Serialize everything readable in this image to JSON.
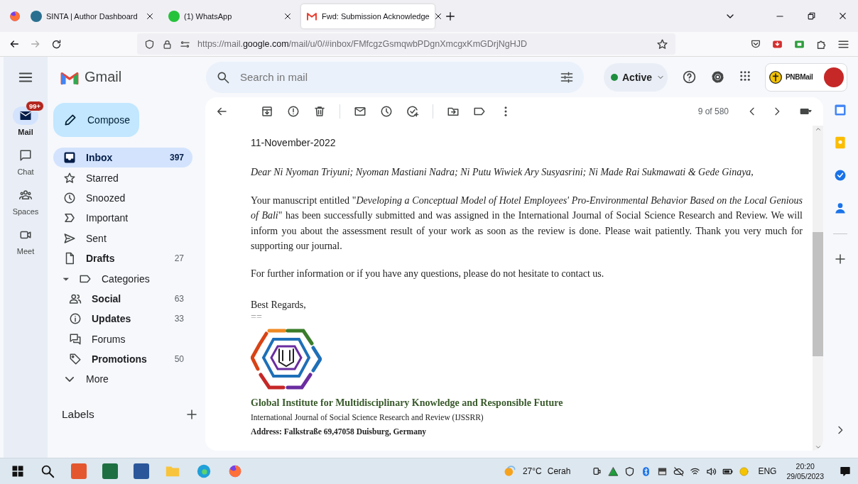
{
  "browser": {
    "tabs": [
      {
        "title": "SINTA | Author Dashboard",
        "selected": false
      },
      {
        "title": "(1) WhatsApp",
        "selected": false
      },
      {
        "title": "Fwd: Submission Acknowledge",
        "selected": true
      }
    ],
    "url": "https://mail.**google.com**/mail/u/0/#inbox/FMfcgzGsmqwbPDgnXmcgxKmGDrjNgHJD"
  },
  "gmail": {
    "app_name": "Gmail",
    "search": {
      "placeholder": "Search in mail"
    },
    "status": "Active",
    "account_logo": "PNBMail",
    "rail": [
      {
        "label": "Mail",
        "selected": true,
        "badge": "99+"
      },
      {
        "label": "Chat",
        "selected": false
      },
      {
        "label": "Spaces",
        "selected": false
      },
      {
        "label": "Meet",
        "selected": false
      }
    ],
    "compose": "Compose",
    "nav": [
      {
        "label": "Inbox",
        "count": "397",
        "bold": true,
        "selected": true
      },
      {
        "label": "Starred",
        "bold": false,
        "selected": false
      },
      {
        "label": "Snoozed",
        "bold": false,
        "selected": false
      },
      {
        "label": "Important",
        "bold": false,
        "selected": false
      },
      {
        "label": "Sent",
        "bold": false,
        "selected": false
      },
      {
        "label": "Drafts",
        "count": "27",
        "bold": true,
        "selected": false
      },
      {
        "label": "Categories",
        "bold": false,
        "selected": false,
        "expanded": true,
        "children": [
          {
            "label": "Social",
            "count": "63",
            "bold": true,
            "selected": false
          },
          {
            "label": "Updates",
            "count": "33",
            "bold": true,
            "selected": false
          },
          {
            "label": "Forums",
            "bold": false,
            "selected": false
          },
          {
            "label": "Promotions",
            "count": "50",
            "bold": true,
            "selected": false
          }
        ]
      },
      {
        "label": "More",
        "bold": false,
        "selected": false
      }
    ],
    "labels_heading": "Labels",
    "pager": "9 of 580",
    "message": {
      "date": "11-November-2022",
      "greeting": "Dear Ni Nyoman Triyuni; Nyoman Mastiani Nadra; Ni Putu Wiwiek Ary Susyasrini; Ni Made Rai Sukmawati & Gede Ginaya,",
      "body": "Your manuscript entitled \"*Developing a Conceptual Model of Hotel Employees' Pro-Environmental Behavior Based on the Local Genious of Bali*\" has been successfully submitted and was assigned in the International Journal of Social Science Research and Review. We will inform you about the assessment result of your work as soon as the review is done. Please wait patiently. Thank you very much for supporting our journal.",
      "further": "For further information or if you have any questions, please do not hesitate to contact us.",
      "closing": "Best Regards,",
      "separator": "==",
      "organization": "Global Institute for Multidisciplinary Knowledge and Responsible Future",
      "journal": "International Journal of Social Science Research and Review (IJSSRR)",
      "address": "Address: Falkstraße 69,47058 Duisburg, Germany"
    }
  },
  "taskbar": {
    "temperature": "27°C",
    "weather": "Cerah",
    "language": "ENG",
    "time": "20:20",
    "date": "29/05/2023"
  }
}
